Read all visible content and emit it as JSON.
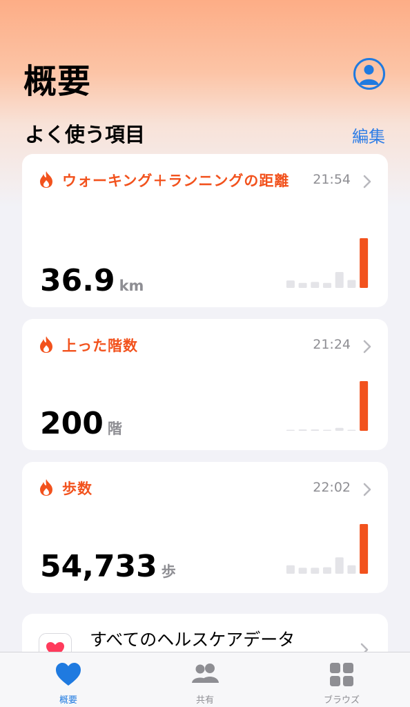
{
  "header": {
    "title": "概要"
  },
  "favorites": {
    "title": "よく使う項目",
    "edit_label": "編集"
  },
  "cards": [
    {
      "title": "ウォーキング＋ランニングの距離",
      "time": "21:54",
      "value": "36.9",
      "unit": "km",
      "icon": "flame-icon",
      "accent": "#f2521d",
      "bars": [
        0.15,
        0.1,
        0.12,
        0.1,
        0.32,
        0.16,
        1.0
      ]
    },
    {
      "title": "上った階数",
      "time": "21:24",
      "value": "200",
      "unit": "階",
      "icon": "flame-icon",
      "accent": "#f2521d",
      "bars": [
        0.0,
        0.02,
        0.02,
        0.0,
        0.06,
        0.0,
        1.0
      ]
    },
    {
      "title": "歩数",
      "time": "22:02",
      "value": "54,733",
      "unit": "歩",
      "icon": "flame-icon",
      "accent": "#f2521d",
      "bars": [
        0.17,
        0.12,
        0.12,
        0.13,
        0.33,
        0.17,
        1.0
      ]
    }
  ],
  "all_data": {
    "label": "すべてのヘルスケアデータ",
    "icon": "heart-icon"
  },
  "tabbar": {
    "tabs": [
      {
        "label": "概要",
        "icon": "heart-icon",
        "active": true
      },
      {
        "label": "共有",
        "icon": "people-icon",
        "active": false
      },
      {
        "label": "ブラウズ",
        "icon": "grid-icon",
        "active": false
      }
    ]
  },
  "colors": {
    "accent_blue": "#1f7ae0",
    "accent_orange": "#f2521d",
    "bar_gray": "#e4e4e8"
  }
}
